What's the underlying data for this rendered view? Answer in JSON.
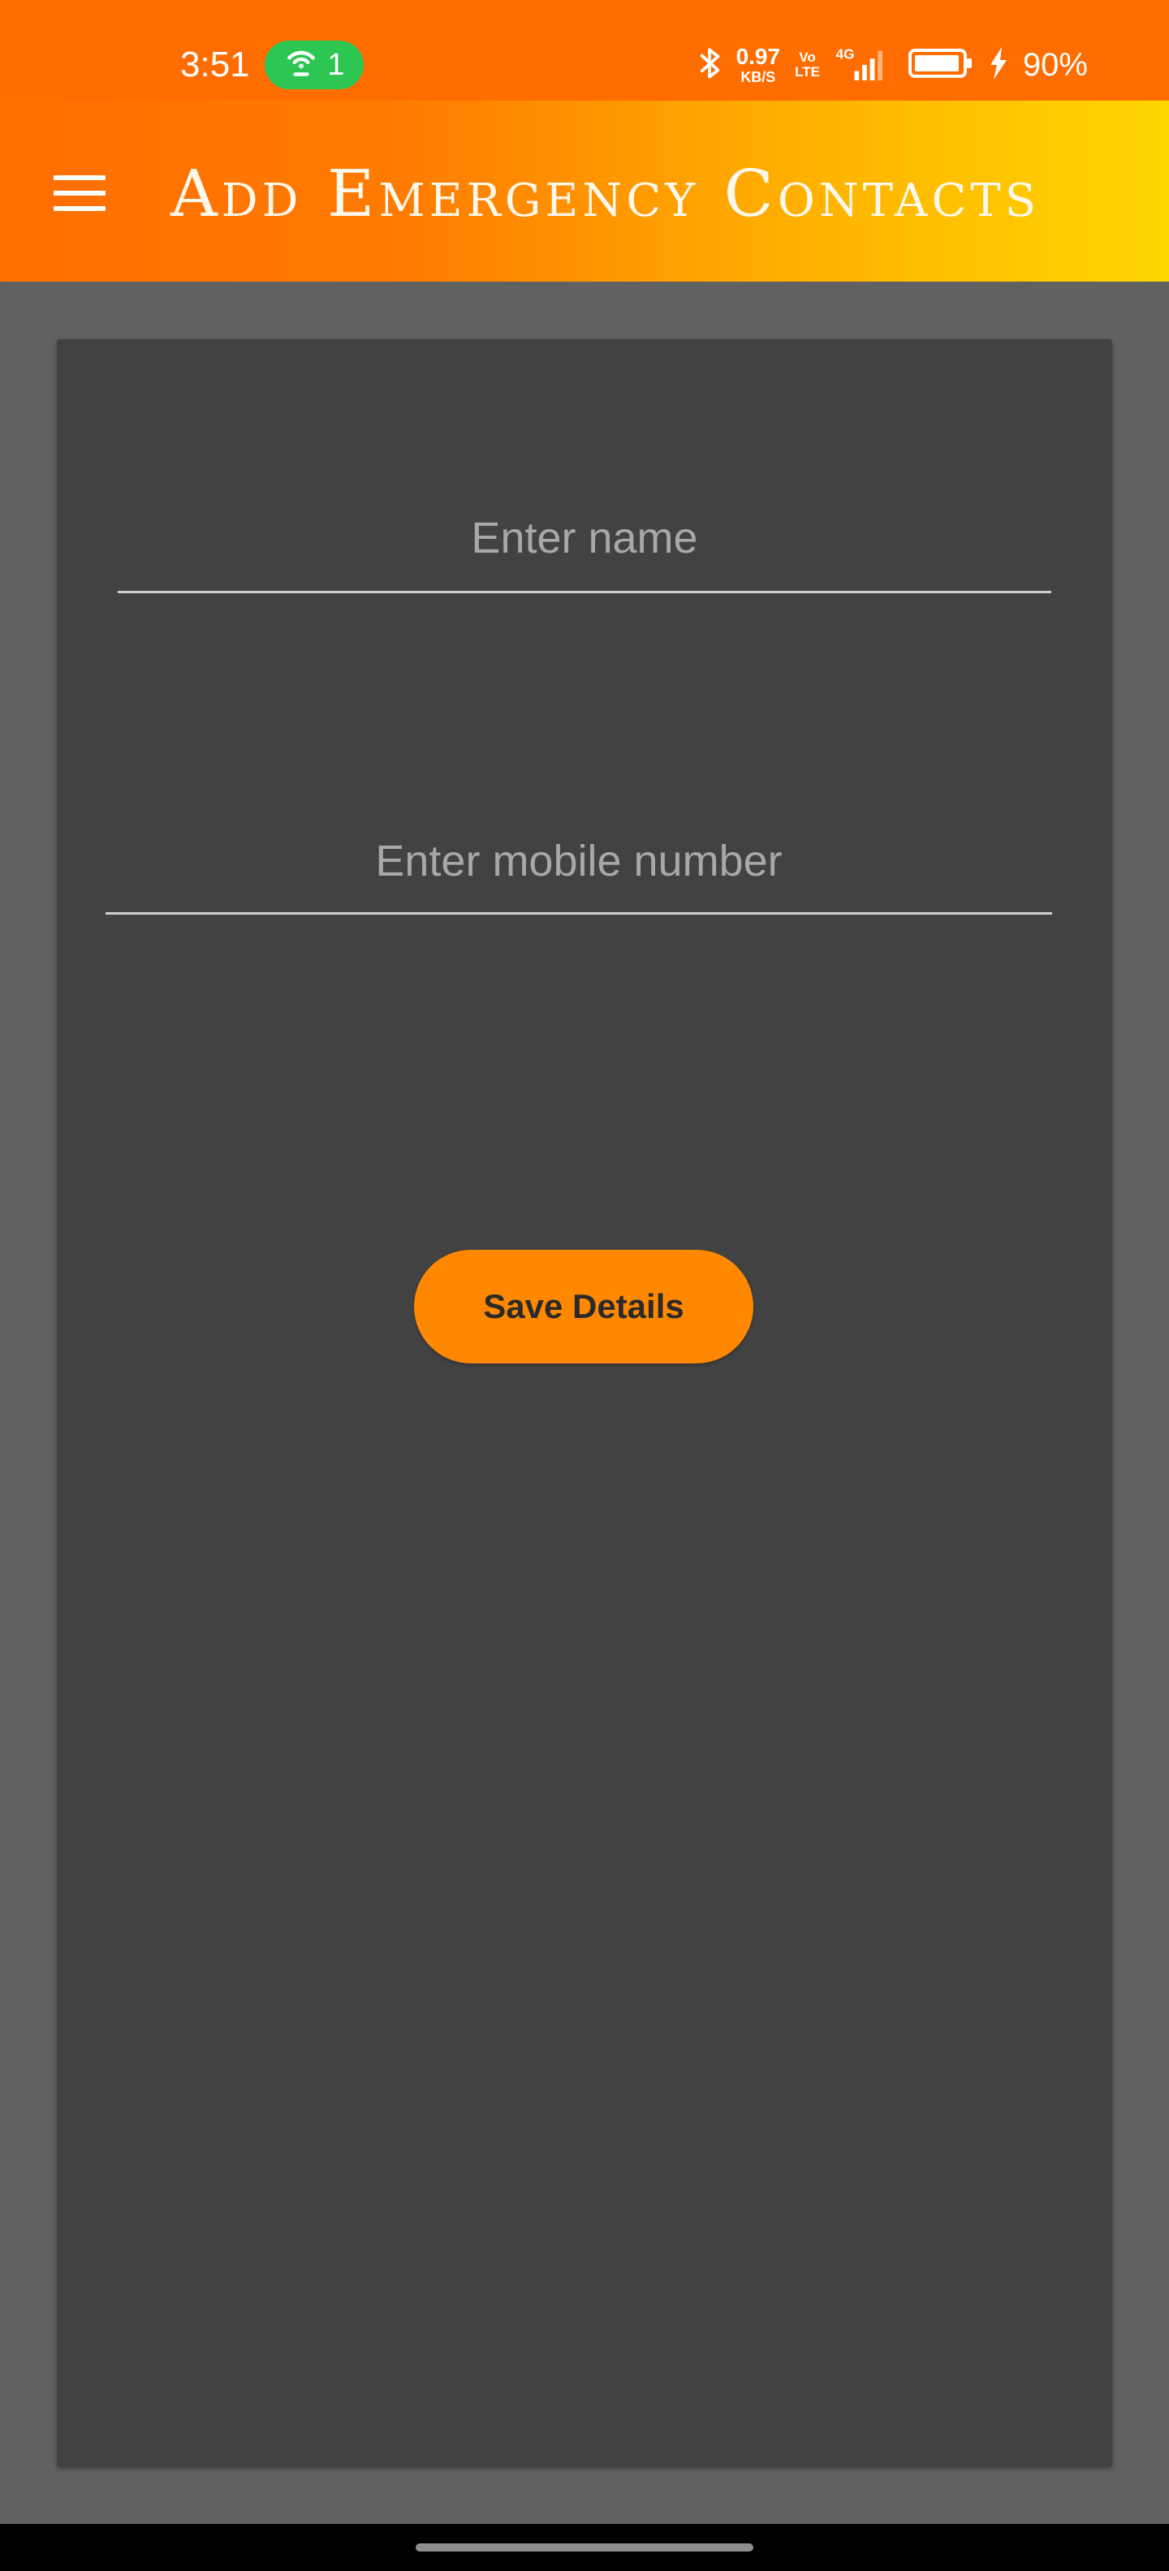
{
  "status_bar": {
    "time": "3:51",
    "hotspot_count": "1",
    "net_speed_value": "0.97",
    "net_speed_unit": "KB/S",
    "volte_top": "Vo",
    "volte_bottom": "LTE",
    "network_type": "4G",
    "battery_percent": "90%",
    "icons": [
      "hotspot-icon",
      "bluetooth-icon",
      "signal-icon",
      "battery-icon",
      "charging-icon"
    ]
  },
  "app_bar": {
    "title": "Add Emergency Contacts",
    "menu_icon": "hamburger-menu-icon"
  },
  "form": {
    "name_placeholder": "Enter name",
    "name_value": "",
    "mobile_placeholder": "Enter mobile number",
    "mobile_value": "",
    "save_label": "Save Details"
  },
  "colors": {
    "status_bar": "#ff6d00",
    "app_bar_start": "#ff6d00",
    "app_bar_end": "#ffd600",
    "background": "#626161",
    "card": "#424242",
    "button": "#ff8800",
    "hotspot_pill": "#2dc653"
  }
}
